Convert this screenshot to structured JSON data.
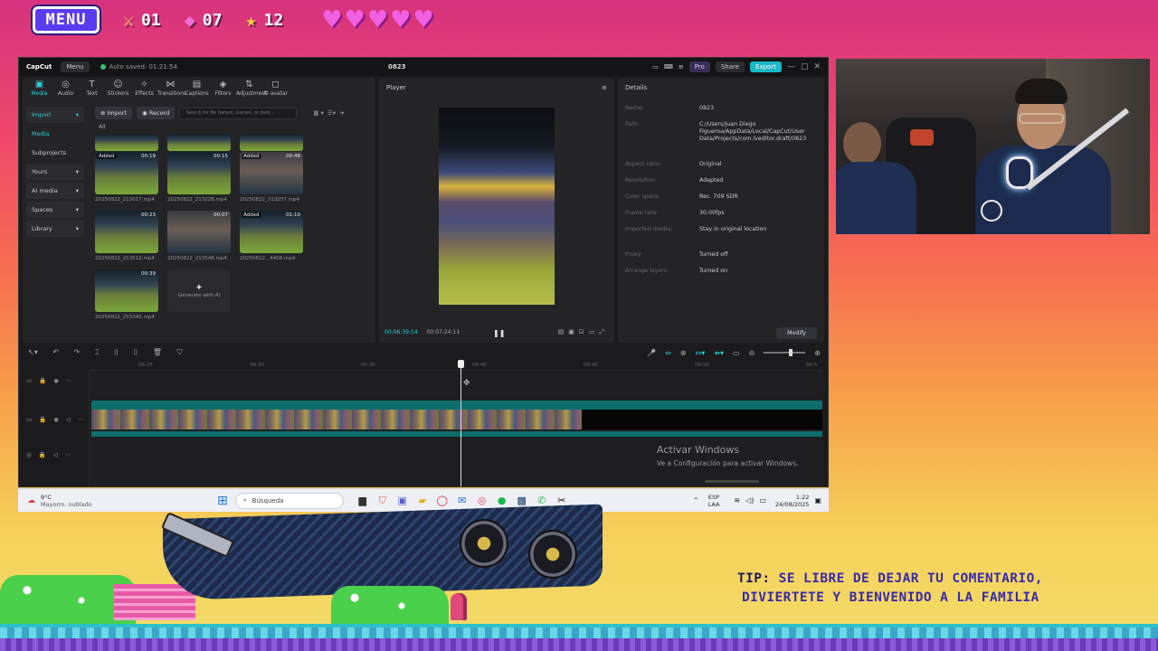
{
  "hud": {
    "menu_label": "MENU",
    "sword_count": "01",
    "gem_count": "07",
    "star_count": "12",
    "hearts": 5
  },
  "capcut": {
    "app_name": "CapCut",
    "menu_label": "Menu",
    "autosave": "Auto saved: 01:21:54",
    "project_name": "0823",
    "pro_label": "Pro",
    "share_label": "Share",
    "export_label": "Export",
    "toolbar": [
      {
        "name": "media",
        "label": "Media",
        "glyph": "▣",
        "active": true
      },
      {
        "name": "audio",
        "label": "Audio",
        "glyph": "◎"
      },
      {
        "name": "text",
        "label": "Text",
        "glyph": "T"
      },
      {
        "name": "stickers",
        "label": "Stickers",
        "glyph": "☺"
      },
      {
        "name": "effects",
        "label": "Effects",
        "glyph": "✧"
      },
      {
        "name": "transitions",
        "label": "Transitions",
        "glyph": "⋈"
      },
      {
        "name": "captions",
        "label": "Captions",
        "glyph": "▤"
      },
      {
        "name": "filters",
        "label": "Filters",
        "glyph": "◈"
      },
      {
        "name": "adjustment",
        "label": "Adjustment",
        "glyph": "⇅"
      },
      {
        "name": "ai-avatar",
        "label": "AI avatar",
        "glyph": "◻"
      }
    ],
    "sidebar": {
      "import": "Import",
      "media": "Media",
      "subprojects": "Subprojects",
      "yours": "Yours",
      "ai_media": "AI media",
      "spaces": "Spaces",
      "library": "Library"
    },
    "media_import_btn": "Import",
    "record_btn": "Record",
    "search_placeholder": "Search for file names, scenes, or dialo...",
    "all_label": "All",
    "clips": [
      {
        "name": "20250822_211211.mp4",
        "added": "",
        "duration": "",
        "kind": "stadium"
      },
      {
        "name": "20250822_211839.mp4",
        "added": "",
        "duration": "",
        "kind": "stadium"
      },
      {
        "name": "20250822_212258.mp4",
        "added": "",
        "duration": "",
        "kind": "stadium"
      },
      {
        "name": "20250822_213017.mp4",
        "added": "Added",
        "duration": "00:19",
        "kind": "stadium"
      },
      {
        "name": "20250822_213228.mp4",
        "added": "",
        "duration": "00:15",
        "kind": "stadium"
      },
      {
        "name": "20250822_213257.mp4",
        "added": "Added",
        "duration": "00:48",
        "kind": "person"
      },
      {
        "name": "20250822_213512.mp4",
        "added": "",
        "duration": "00:23",
        "kind": "stadium"
      },
      {
        "name": "20250822_213548.mp4",
        "added": "",
        "duration": "00:07",
        "kind": "person"
      },
      {
        "name": "20250822...4408.mp4",
        "added": "Added",
        "duration": "01:10",
        "kind": "stadium"
      },
      {
        "name": "20250822_215345.mp4",
        "added": "",
        "duration": "00:39",
        "kind": "stadium"
      }
    ],
    "generate_ai": "Generate with AI",
    "player": {
      "title": "Player",
      "current_time": "00:06:39:14",
      "total_time": "00:07:24:11"
    },
    "details": {
      "title": "Details",
      "rows": [
        {
          "label": "Name:",
          "value": "0823"
        },
        {
          "label": "Path:",
          "value": "C:/Users/Juan Diego Figueroa/AppData/Local/CapCut/User Data/Projects/com.lveditor.draft/0823"
        },
        {
          "label": "Aspect ratio:",
          "value": "Original"
        },
        {
          "label": "Resolution:",
          "value": "Adapted"
        },
        {
          "label": "Color space:",
          "value": "Rec. 709 SDR"
        },
        {
          "label": "Frame rate:",
          "value": "30.00fps"
        },
        {
          "label": "Imported media:",
          "value": "Stay in original location"
        },
        {
          "label": "Proxy:",
          "value": "Turned off"
        },
        {
          "label": "Arrange layers:",
          "value": "Turned on"
        }
      ],
      "modify_label": "Modify"
    },
    "ruler_ticks": [
      "06:25",
      "06:30",
      "06:35",
      "06:40",
      "06:45",
      "06:50",
      "06:5"
    ],
    "activate_title": "Activar Windows",
    "activate_sub": "Ve a Configuración para activar Windows."
  },
  "taskbar": {
    "temp": "9°C",
    "weather": "Mayorm. nublado",
    "search_label": "Búsqueda",
    "lang_top": "ESP",
    "lang_bottom": "LAA",
    "time": "1:22",
    "date": "24/08/2025"
  },
  "tip": {
    "label": "TIP:",
    "line1": "SE LIBRE DE DEJAR TU COMENTARIO,",
    "line2": "DIVIERTETE Y BIENVENIDO A LA FAMILIA"
  }
}
